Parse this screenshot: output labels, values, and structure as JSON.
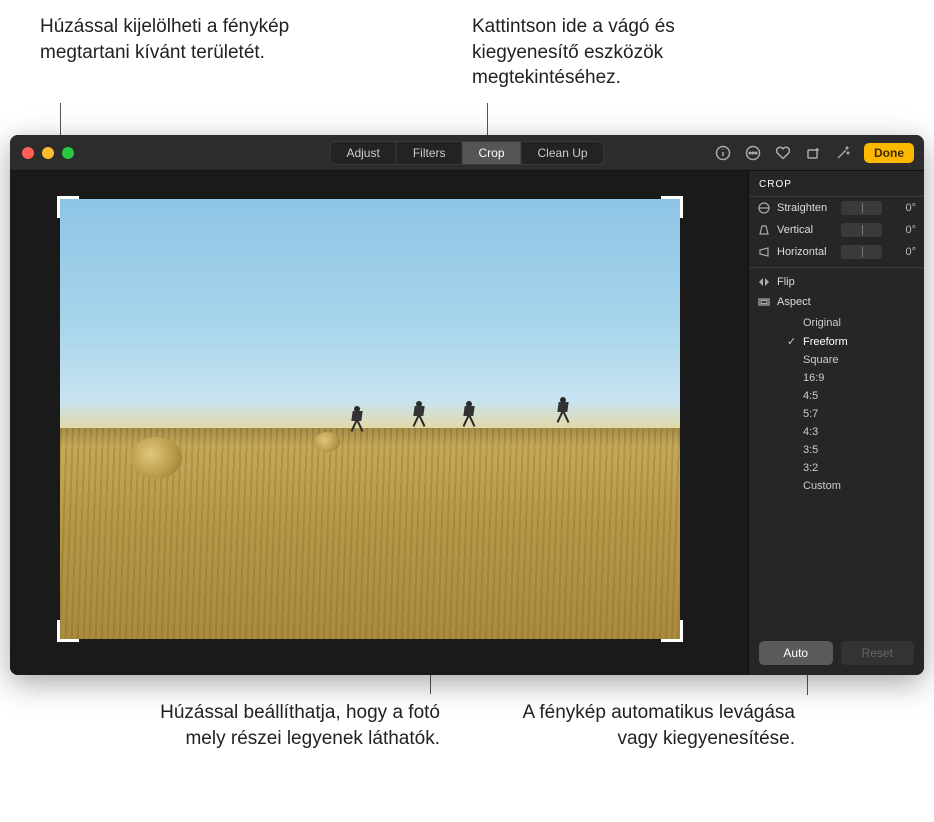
{
  "callouts": {
    "top_left": "Húzással kijelölheti a fénykép megtartani kívánt területét.",
    "top_right": "Kattintson ide a vágó és kiegyenesítő eszközök megtekintéséhez.",
    "bottom_left": "Húzással beállíthatja, hogy a fotó mely részei legyenek láthatók.",
    "bottom_right": "A fénykép automatikus levágása vagy kiegyenesítése."
  },
  "toolbar": {
    "tabs": {
      "adjust": "Adjust",
      "filters": "Filters",
      "crop": "Crop",
      "cleanup": "Clean Up"
    },
    "done": "Done"
  },
  "panel": {
    "title": "CROP",
    "straighten": {
      "label": "Straighten",
      "value": "0°"
    },
    "vertical": {
      "label": "Vertical",
      "value": "0°"
    },
    "horizontal": {
      "label": "Horizontal",
      "value": "0°"
    },
    "flip": "Flip",
    "aspect": "Aspect",
    "aspect_options": {
      "original": "Original",
      "freeform": "Freeform",
      "square": "Square",
      "r16_9": "16:9",
      "r4_5": "4:5",
      "r5_7": "5:7",
      "r4_3": "4:3",
      "r3_5": "3:5",
      "r3_2": "3:2",
      "custom": "Custom"
    },
    "auto": "Auto",
    "reset": "Reset"
  }
}
